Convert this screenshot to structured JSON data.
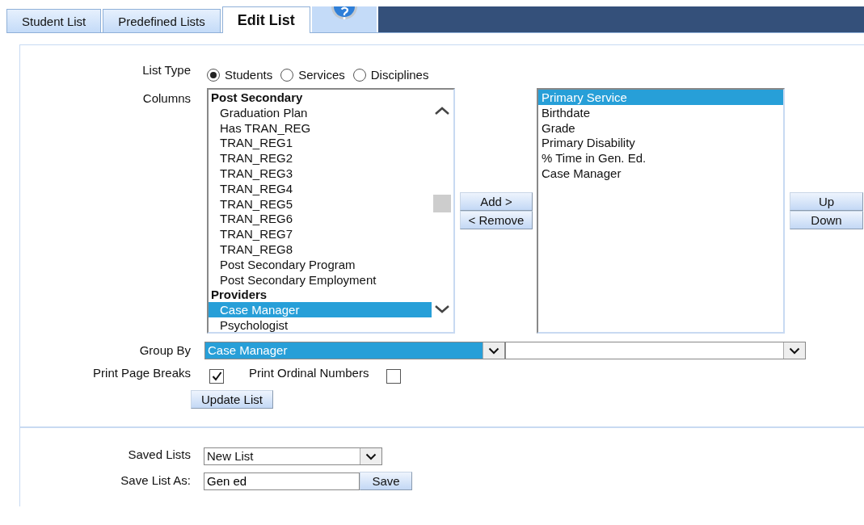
{
  "tabs": [
    {
      "label": "Student List",
      "selected": false
    },
    {
      "label": "Predefined Lists",
      "selected": false
    },
    {
      "label": "Edit List",
      "selected": true
    }
  ],
  "list_type": {
    "label": "List Type",
    "options": [
      {
        "label": "Students",
        "selected": true
      },
      {
        "label": "Services",
        "selected": false
      },
      {
        "label": "Disciplines",
        "selected": false
      }
    ]
  },
  "columns": {
    "label": "Columns",
    "available": [
      {
        "kind": "group",
        "label": "Post Secondary",
        "selected": false
      },
      {
        "kind": "item",
        "label": "Graduation Plan",
        "selected": false
      },
      {
        "kind": "item",
        "label": "Has TRAN_REG",
        "selected": false
      },
      {
        "kind": "item",
        "label": "TRAN_REG1",
        "selected": false
      },
      {
        "kind": "item",
        "label": "TRAN_REG2",
        "selected": false
      },
      {
        "kind": "item",
        "label": "TRAN_REG3",
        "selected": false
      },
      {
        "kind": "item",
        "label": "TRAN_REG4",
        "selected": false
      },
      {
        "kind": "item",
        "label": "TRAN_REG5",
        "selected": false
      },
      {
        "kind": "item",
        "label": "TRAN_REG6",
        "selected": false
      },
      {
        "kind": "item",
        "label": "TRAN_REG7",
        "selected": false
      },
      {
        "kind": "item",
        "label": "TRAN_REG8",
        "selected": false
      },
      {
        "kind": "item",
        "label": "Post Secondary Program",
        "selected": false
      },
      {
        "kind": "item",
        "label": "Post Secondary Employment",
        "selected": false
      },
      {
        "kind": "group",
        "label": "Providers",
        "selected": false
      },
      {
        "kind": "item",
        "label": "Case Manager",
        "selected": true
      },
      {
        "kind": "item",
        "label": "Psychologist",
        "selected": false
      }
    ],
    "move_buttons": [
      "Add >",
      "< Remove"
    ],
    "chosen": [
      {
        "label": "Primary Service",
        "selected": true
      },
      {
        "label": "Birthdate",
        "selected": false
      },
      {
        "label": "Grade",
        "selected": false
      },
      {
        "label": "Primary Disability",
        "selected": false
      },
      {
        "label": "% Time in Gen. Ed.",
        "selected": false
      },
      {
        "label": "Case Manager",
        "selected": false
      }
    ],
    "order_buttons": [
      "Up",
      "Down"
    ]
  },
  "group_by": {
    "label": "Group By",
    "value": "Case Manager",
    "value_2_selected": false
  },
  "print_page_breaks": {
    "label": "Print Page Breaks",
    "checked": true
  },
  "print_ordinal_numbers": {
    "label": "Print Ordinal Numbers",
    "checked": false
  },
  "update_button": "Update List",
  "saved_lists": {
    "label": "Saved Lists",
    "value": "New List"
  },
  "save_list_as": {
    "label": "Save List As:",
    "value": "Gen ed",
    "button": "Save"
  }
}
